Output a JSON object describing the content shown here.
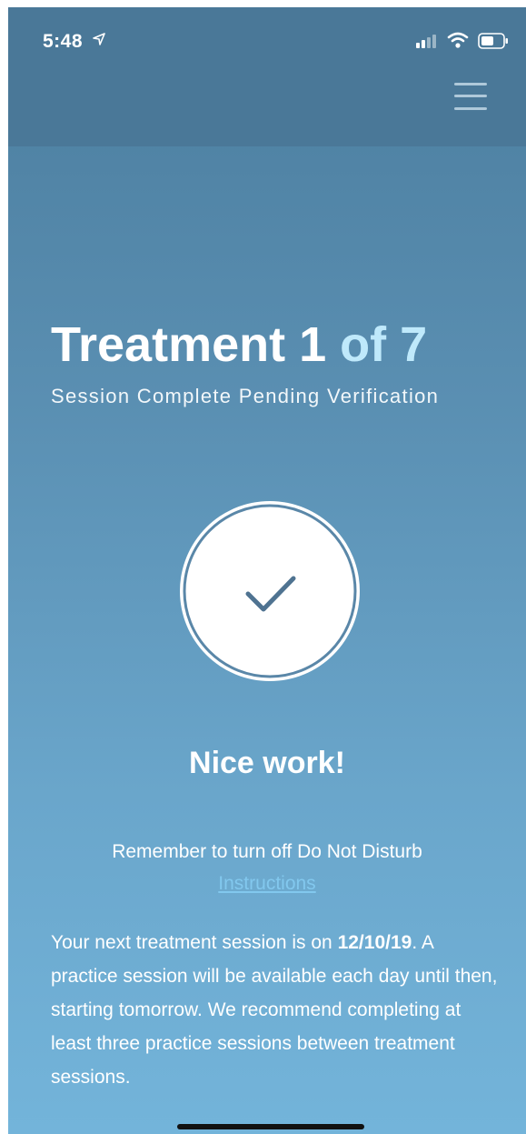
{
  "status_bar": {
    "time": "5:48",
    "icons": [
      "location-arrow-icon",
      "cellular-signal-icon",
      "wifi-icon",
      "battery-icon"
    ]
  },
  "header": {
    "menu_icon": "hamburger-menu-icon"
  },
  "treatment": {
    "title_prefix": "Treatment 1",
    "title_suffix": "of 7",
    "subtitle": "Session Complete Pending Verification"
  },
  "completion": {
    "icon": "checkmark-icon",
    "message": "Nice work!"
  },
  "reminder": {
    "text": "Remember to turn off Do Not Disturb",
    "link_label": "Instructions"
  },
  "next_session": {
    "text_before": "Your next treatment session is on ",
    "date": "12/10/19",
    "text_after": ". A practice session will be available each day until then, starting tomorrow. We recommend completing at least three practice sessions between treatment sessions."
  },
  "colors": {
    "header_bg": "#4a7898",
    "gradient_top": "#4b7d9e",
    "gradient_bottom": "#73b4da",
    "accent_light": "#bfe9fb",
    "link": "#82c8ee",
    "check_stroke": "#4f7391"
  }
}
